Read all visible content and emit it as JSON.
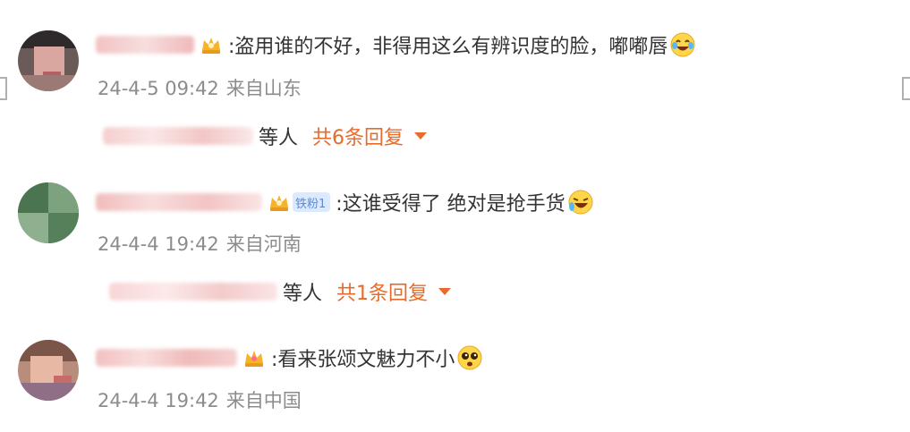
{
  "comments": [
    {
      "text": ":盗用谁的不好，非得用这么有辨识度的脸，嘟嘟唇",
      "time": "24-4-5 09:42",
      "location": "来自山东",
      "emoji": "laughing-tears",
      "badge": "",
      "replies": {
        "suffix": "等人",
        "count": "共6条回复"
      }
    },
    {
      "text": ":这谁受得了 绝对是抢手货",
      "time": "24-4-4 19:42",
      "location": "来自河南",
      "emoji": "rolling-laughing",
      "badge": "铁粉1",
      "replies": {
        "suffix": "等人",
        "count": "共1条回复"
      }
    },
    {
      "text": ":看来张颂文魅力不小",
      "time": "24-4-4 19:42",
      "location": "来自中国",
      "emoji": "pleading-face",
      "badge": ""
    }
  ],
  "colors": {
    "text": "#333333",
    "meta": "#8c8c8c",
    "reply_accent": "#e86b2b",
    "badge_bg": "#dbeaff"
  },
  "icons": [
    "crown-icon",
    "caret-down-icon",
    "emoji-icon",
    "edge-bracket-icon"
  ]
}
